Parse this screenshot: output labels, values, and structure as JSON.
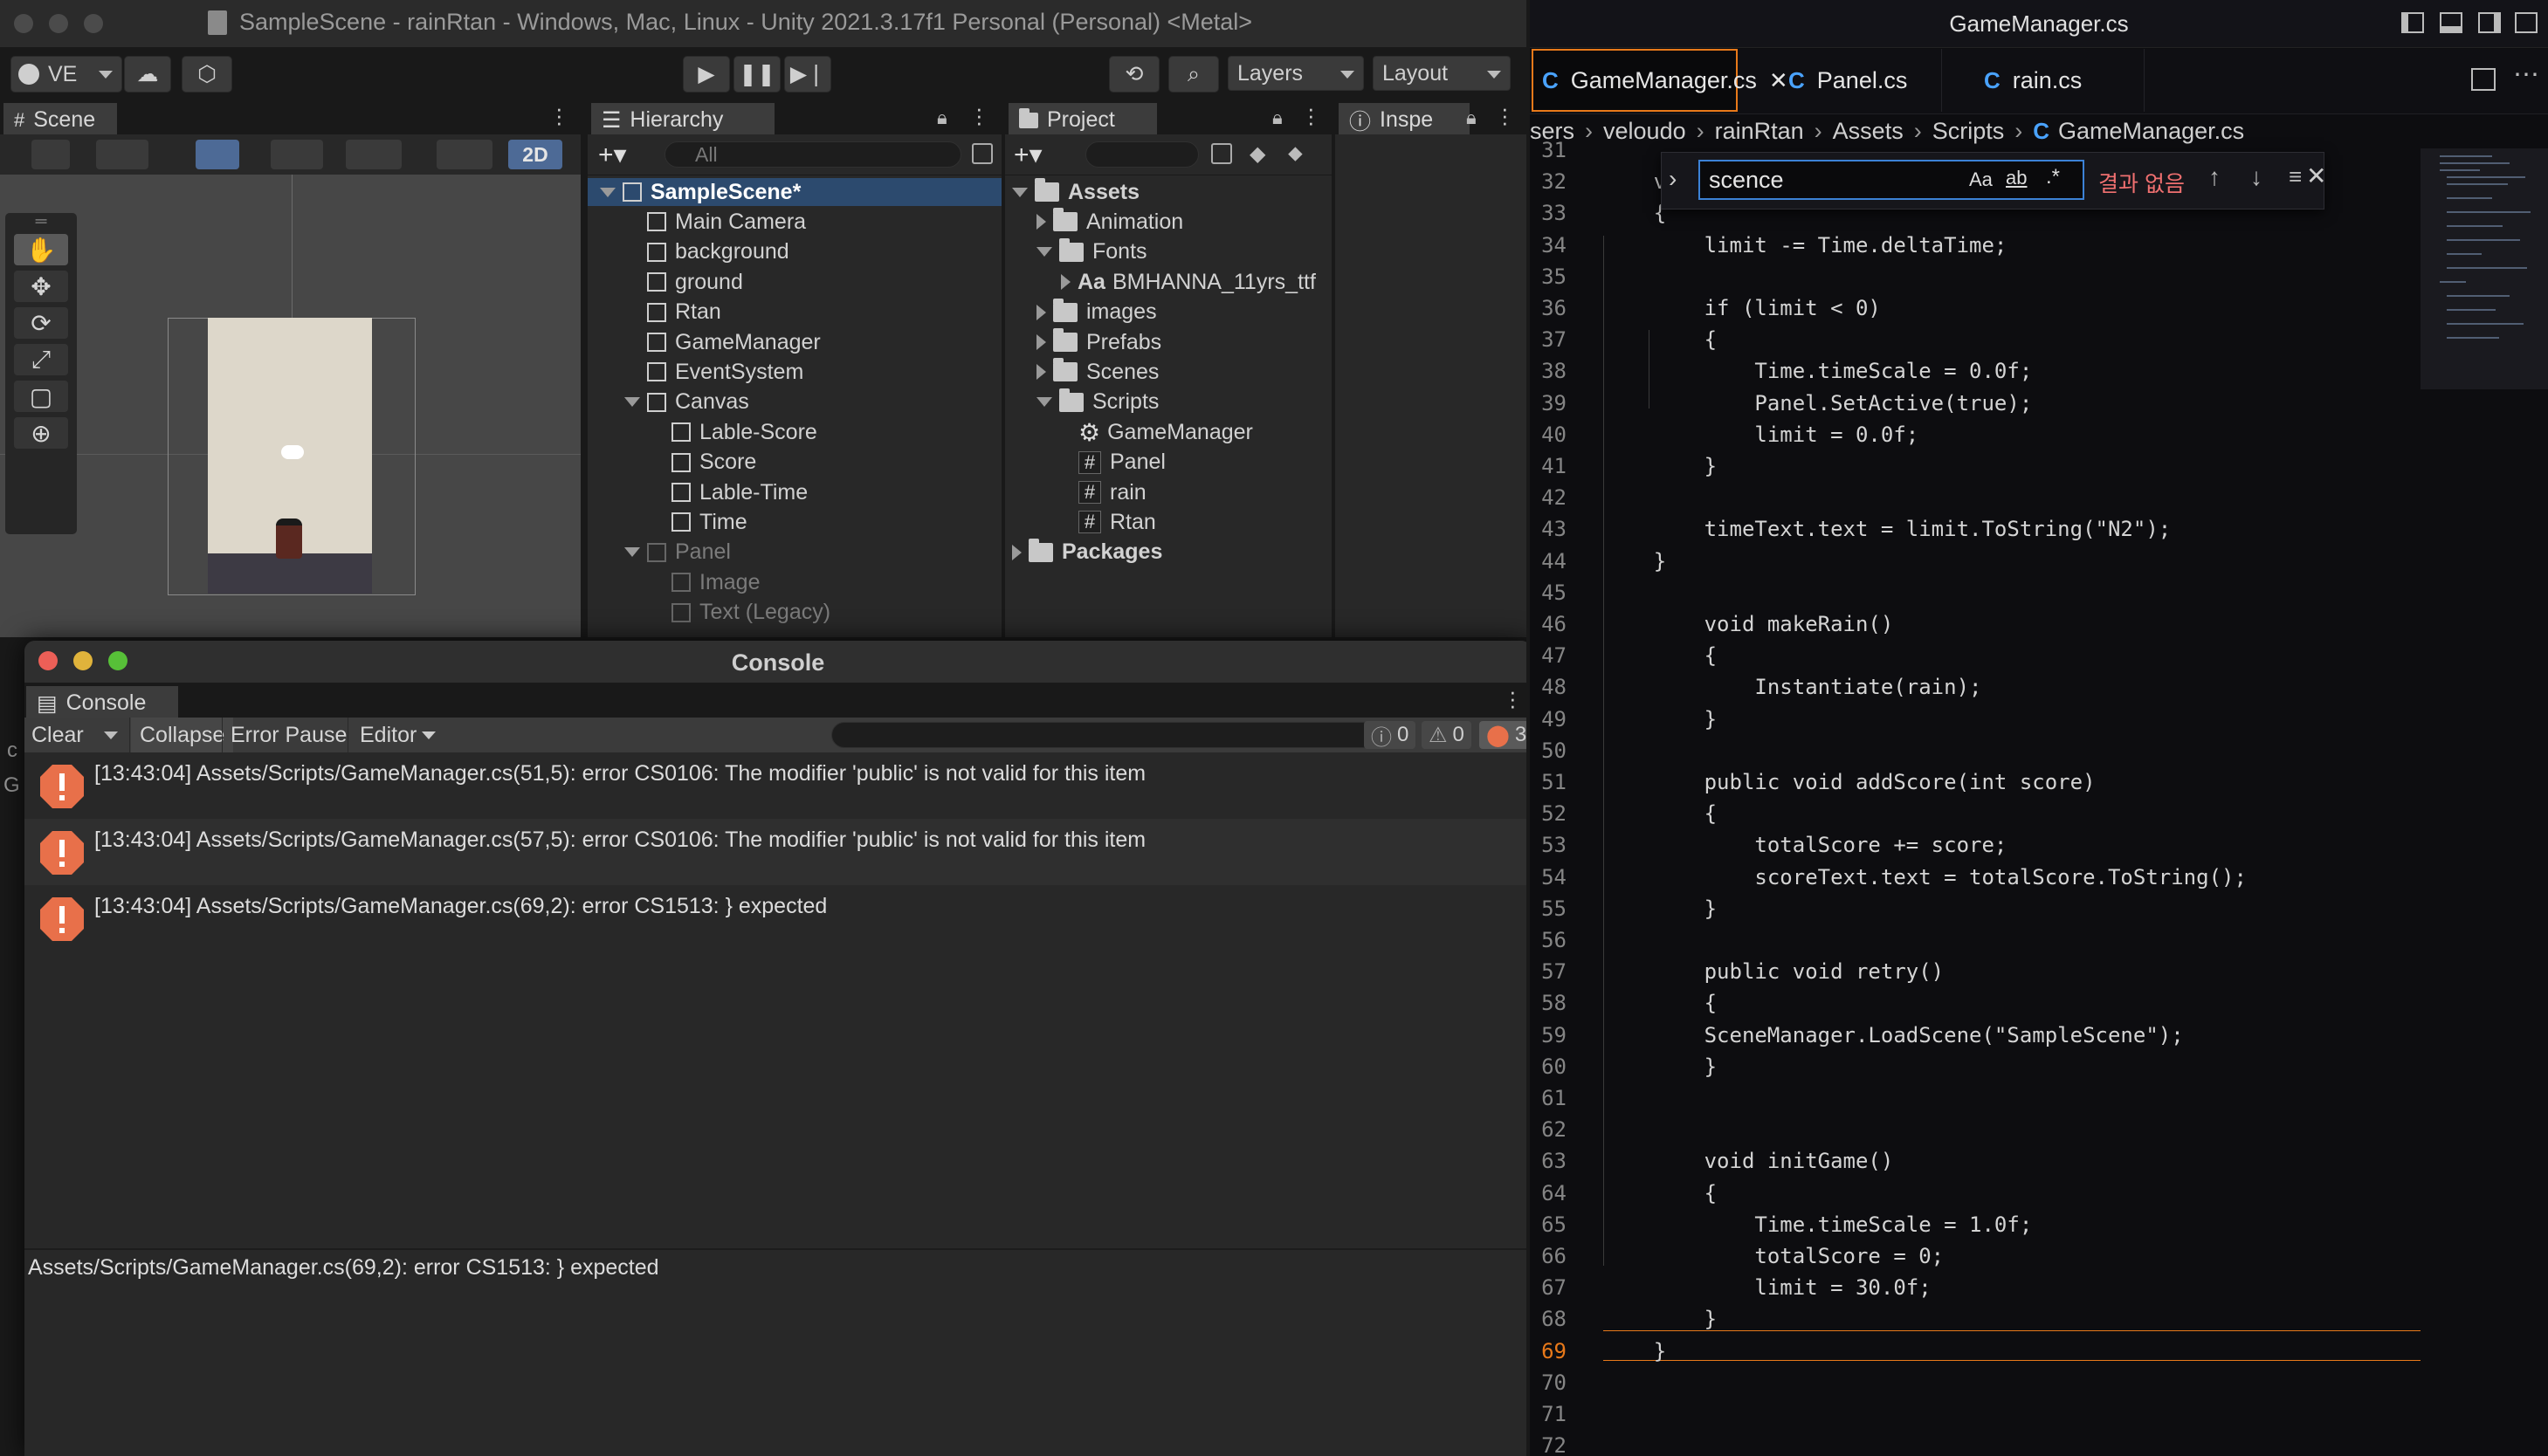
{
  "unity": {
    "title": "SampleScene - rainRtan - Windows, Mac, Linux - Unity 2021.3.17f1 Personal (Personal) <Metal>",
    "account_label": "VE",
    "layers_label": "Layers",
    "layout_label": "Layout",
    "scene_tab": "Scene",
    "scene_2d_label": "2D",
    "hierarchy_tab": "Hierarchy",
    "hierarchy_search_placeholder": "All",
    "hierarchy_items": [
      {
        "label": "SampleScene*",
        "depth": 0,
        "kind": "scene",
        "expanded": true
      },
      {
        "label": "Main Camera",
        "depth": 1,
        "kind": "object"
      },
      {
        "label": "background",
        "depth": 1,
        "kind": "object"
      },
      {
        "label": "ground",
        "depth": 1,
        "kind": "object"
      },
      {
        "label": "Rtan",
        "depth": 1,
        "kind": "object"
      },
      {
        "label": "GameManager",
        "depth": 1,
        "kind": "object"
      },
      {
        "label": "EventSystem",
        "depth": 1,
        "kind": "object"
      },
      {
        "label": "Canvas",
        "depth": 1,
        "kind": "object",
        "expanded": true
      },
      {
        "label": "Lable-Score",
        "depth": 2,
        "kind": "object"
      },
      {
        "label": "Score",
        "depth": 2,
        "kind": "object"
      },
      {
        "label": "Lable-Time",
        "depth": 2,
        "kind": "object"
      },
      {
        "label": "Time",
        "depth": 2,
        "kind": "object"
      },
      {
        "label": "Panel",
        "depth": 1,
        "kind": "object",
        "expanded": true,
        "inactive": true
      },
      {
        "label": "Image",
        "depth": 2,
        "kind": "object",
        "inactive": true
      },
      {
        "label": "Text (Legacy)",
        "depth": 2,
        "kind": "object",
        "inactive": true
      }
    ],
    "project_tab": "Project",
    "project_items": [
      {
        "label": "Assets",
        "depth": 0,
        "kind": "folder",
        "expanded": true,
        "bold": true
      },
      {
        "label": "Animation",
        "depth": 1,
        "kind": "folder",
        "collapsed": true
      },
      {
        "label": "Fonts",
        "depth": 1,
        "kind": "folder",
        "expanded": true
      },
      {
        "label": "BMHANNA_11yrs_ttf",
        "depth": 2,
        "kind": "font",
        "collapsed": true
      },
      {
        "label": "images",
        "depth": 1,
        "kind": "folder",
        "collapsed": true
      },
      {
        "label": "Prefabs",
        "depth": 1,
        "kind": "folder",
        "collapsed": true
      },
      {
        "label": "Scenes",
        "depth": 1,
        "kind": "folder",
        "collapsed": true
      },
      {
        "label": "Scripts",
        "depth": 1,
        "kind": "folder",
        "expanded": true
      },
      {
        "label": "GameManager",
        "depth": 2,
        "kind": "gear"
      },
      {
        "label": "Panel",
        "depth": 2,
        "kind": "script"
      },
      {
        "label": "rain",
        "depth": 2,
        "kind": "script"
      },
      {
        "label": "Rtan",
        "depth": 2,
        "kind": "script"
      },
      {
        "label": "Packages",
        "depth": 0,
        "kind": "folder",
        "collapsed": true,
        "bold": true
      }
    ],
    "font_prefix": "Aa",
    "inspector_tab": "Inspe",
    "console": {
      "window_title": "Console",
      "tab": "Console",
      "clear": "Clear",
      "collapse": "Collapse",
      "error_pause": "Error Pause",
      "editor": "Editor",
      "count_info": "0",
      "count_warn": "0",
      "count_error": "3",
      "entries": [
        "[13:43:04] Assets/Scripts/GameManager.cs(51,5): error CS0106: The modifier 'public' is not valid for this item",
        "[13:43:04] Assets/Scripts/GameManager.cs(57,5): error CS0106: The modifier 'public' is not valid for this item",
        "[13:43:04] Assets/Scripts/GameManager.cs(69,2): error CS1513: } expected"
      ],
      "detail": "Assets/Scripts/GameManager.cs(69,2): error CS1513: } expected"
    },
    "left_edge_letters": [
      "c",
      "G"
    ]
  },
  "vscode": {
    "title": "GameManager.cs",
    "tabs": [
      {
        "label": "GameManager.cs",
        "active": true
      },
      {
        "label": "Panel.cs",
        "active": false
      },
      {
        "label": "rain.cs",
        "active": false
      }
    ],
    "breadcrumb": [
      "sers",
      "veloudo",
      "rainRtan",
      "Assets",
      "Scripts",
      "GameManager.cs"
    ],
    "find": {
      "value": "scence",
      "result": "결과 없음",
      "opt_case": "Aa",
      "opt_word": "ab",
      "opt_regex": ".*"
    },
    "lines": [
      {
        "n": "31",
        "t": ""
      },
      {
        "n": "32",
        "t": "    void"
      },
      {
        "n": "33",
        "t": "    {"
      },
      {
        "n": "34",
        "t": "        limit -= Time.deltaTime;"
      },
      {
        "n": "35",
        "t": ""
      },
      {
        "n": "36",
        "t": "        if (limit < 0)"
      },
      {
        "n": "37",
        "t": "        {"
      },
      {
        "n": "38",
        "t": "            Time.timeScale = 0.0f;"
      },
      {
        "n": "39",
        "t": "            Panel.SetActive(true);"
      },
      {
        "n": "40",
        "t": "            limit = 0.0f;"
      },
      {
        "n": "41",
        "t": "        }"
      },
      {
        "n": "42",
        "t": ""
      },
      {
        "n": "43",
        "t": "        timeText.text = limit.ToString(\"N2\");"
      },
      {
        "n": "44",
        "t": "    }"
      },
      {
        "n": "45",
        "t": ""
      },
      {
        "n": "46",
        "t": "        void makeRain()"
      },
      {
        "n": "47",
        "t": "        {"
      },
      {
        "n": "48",
        "t": "            Instantiate(rain);"
      },
      {
        "n": "49",
        "t": "        }"
      },
      {
        "n": "50",
        "t": ""
      },
      {
        "n": "51",
        "t": "        public void addScore(int score)"
      },
      {
        "n": "52",
        "t": "        {"
      },
      {
        "n": "53",
        "t": "            totalScore += score;"
      },
      {
        "n": "54",
        "t": "            scoreText.text = totalScore.ToString();"
      },
      {
        "n": "55",
        "t": "        }"
      },
      {
        "n": "56",
        "t": ""
      },
      {
        "n": "57",
        "t": "        public void retry()"
      },
      {
        "n": "58",
        "t": "        {"
      },
      {
        "n": "59",
        "t": "        SceneManager.LoadScene(\"SampleScene\");"
      },
      {
        "n": "60",
        "t": "        }"
      },
      {
        "n": "61",
        "t": ""
      },
      {
        "n": "62",
        "t": ""
      },
      {
        "n": "63",
        "t": "        void initGame()"
      },
      {
        "n": "64",
        "t": "        {"
      },
      {
        "n": "65",
        "t": "            Time.timeScale = 1.0f;"
      },
      {
        "n": "66",
        "t": "            totalScore = 0;"
      },
      {
        "n": "67",
        "t": "            limit = 30.0f;"
      },
      {
        "n": "68",
        "t": "        }"
      },
      {
        "n": "69",
        "t": "    }"
      },
      {
        "n": "70",
        "t": ""
      },
      {
        "n": "71",
        "t": ""
      },
      {
        "n": "72",
        "t": ""
      }
    ]
  },
  "colors": {
    "accent_orange": "#e8791a",
    "find_border": "#3c82d6",
    "error_icon": "#e8704a",
    "csharp_icon": "#4aa3ff",
    "no_results": "#f07070",
    "unity_selected_row": "#2c4a6e"
  }
}
